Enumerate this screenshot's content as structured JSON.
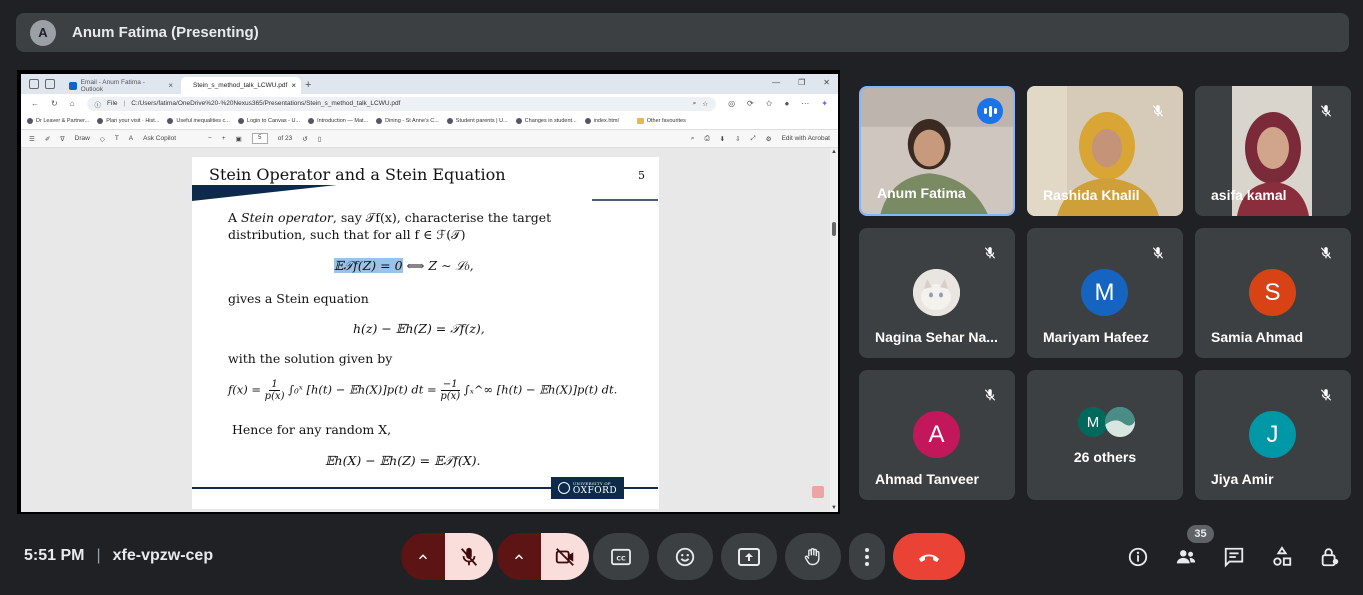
{
  "presenter_bar": {
    "avatar_letter": "A",
    "title": "Anum Fatima (Presenting)"
  },
  "browser": {
    "tabs": [
      {
        "label": "Email - Anum Fatima - Outlook",
        "active": false
      },
      {
        "label": "Stein_s_method_talk_LCWU.pdf",
        "active": true
      }
    ],
    "url_scheme": "File",
    "url": "C:/Users/fatima/OneDrive%20-%20Nexus365/Presentations/Stein_s_method_talk_LCWU.pdf",
    "bookmarks": [
      "Dr Leaver & Partner...",
      "Plan your visit · Hist...",
      "Useful inequalities c...",
      "Login to Canvas - U...",
      "Introduction — Mat...",
      "Dining - St Anne's C...",
      "Student parents | U...",
      "Changes in student...",
      "index.html",
      "Other favourites"
    ],
    "pdf_toolbar": {
      "draw": "Draw",
      "copilot": "Ask Copilot",
      "page": "5",
      "of_pages": "of 23",
      "edit": "Edit with Acrobat"
    }
  },
  "slide": {
    "title": "Stein Operator and a Stein Equation",
    "number": "5",
    "para1_a": "A ",
    "para1_em": "Stein operator",
    "para1_b": ", say 𝒯f(x), characterise the target",
    "para1_c": "distribution, such that for all f ∈ ℱ(𝒯)",
    "eq1_hl": "𝔼𝒯f(Z) = 0",
    "eq1_rest": " ⟺  Z ∼ ℒ₀,",
    "para2": "gives a Stein equation",
    "eq2": "h(z) − 𝔼h(Z) = 𝒯f(z),",
    "para3": "with the solution given by",
    "eq3_a": "f(x) = ",
    "eq3_n1": "1",
    "eq3_d1": "p(x)",
    "eq3_b": " ∫₀ˣ [h(t) − 𝔼h(X)]p(t) dt = ",
    "eq3_n2": "−1",
    "eq3_d2": "p(x)",
    "eq3_c": " ∫ₓ^∞ [h(t) − 𝔼h(X)]p(t) dt.",
    "para4": "Hence for any random X,",
    "eq4": "𝔼h(X) − 𝔼h(Z) = 𝔼𝒯f(X).",
    "logo_small": "UNIVERSITY OF",
    "logo_big": "OXFORD"
  },
  "participants": [
    {
      "name": "Anum Fatima",
      "type": "video",
      "speaking": true
    },
    {
      "name": "Rashida Khalil",
      "type": "video",
      "muted": true
    },
    {
      "name": "asifa kamal",
      "type": "video",
      "muted": true
    },
    {
      "name": "Nagina Sehar Na...",
      "type": "photo",
      "muted": true
    },
    {
      "name": "Mariyam Hafeez",
      "type": "avatar",
      "letter": "M",
      "color": "#1565c0",
      "muted": true
    },
    {
      "name": "Samia Ahmad",
      "type": "avatar",
      "letter": "S",
      "color": "#d84315",
      "muted": true
    },
    {
      "name": "Ahmad Tanveer",
      "type": "avatar",
      "letter": "A",
      "color": "#c2185b",
      "muted": true
    },
    {
      "name": "26 others",
      "type": "others",
      "letter": "M"
    },
    {
      "name": "Jiya Amir",
      "type": "avatar",
      "letter": "J",
      "color": "#0097a7",
      "muted": true
    }
  ],
  "meeting": {
    "time": "5:51 PM",
    "code": "xfe-vpzw-cep",
    "participant_count": "35"
  },
  "colors": {
    "bg": "#202124",
    "tile": "#3c4043",
    "leave": "#ea4335",
    "muted_bg": "#f9dedc"
  }
}
